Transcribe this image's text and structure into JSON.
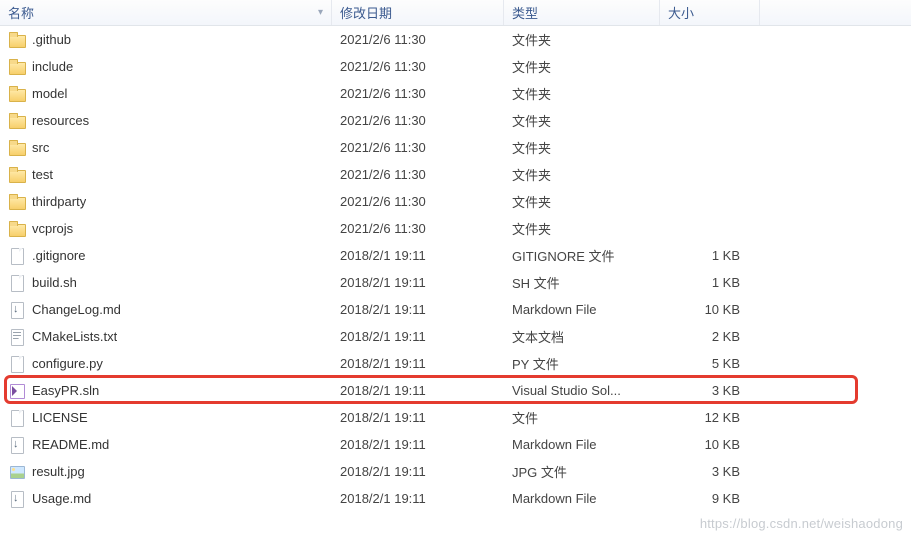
{
  "columns": {
    "name": "名称",
    "date": "修改日期",
    "type": "类型",
    "size": "大小"
  },
  "watermark": "https://blog.csdn.net/weishaodong",
  "rows": [
    {
      "icon": "folder",
      "name": ".github",
      "date": "2021/2/6 11:30",
      "type": "文件夹",
      "size": ""
    },
    {
      "icon": "folder",
      "name": "include",
      "date": "2021/2/6 11:30",
      "type": "文件夹",
      "size": ""
    },
    {
      "icon": "folder",
      "name": "model",
      "date": "2021/2/6 11:30",
      "type": "文件夹",
      "size": ""
    },
    {
      "icon": "folder",
      "name": "resources",
      "date": "2021/2/6 11:30",
      "type": "文件夹",
      "size": ""
    },
    {
      "icon": "folder",
      "name": "src",
      "date": "2021/2/6 11:30",
      "type": "文件夹",
      "size": ""
    },
    {
      "icon": "folder",
      "name": "test",
      "date": "2021/2/6 11:30",
      "type": "文件夹",
      "size": ""
    },
    {
      "icon": "folder",
      "name": "thirdparty",
      "date": "2021/2/6 11:30",
      "type": "文件夹",
      "size": ""
    },
    {
      "icon": "folder",
      "name": "vcprojs",
      "date": "2021/2/6 11:30",
      "type": "文件夹",
      "size": ""
    },
    {
      "icon": "file",
      "name": ".gitignore",
      "date": "2018/2/1 19:11",
      "type": "GITIGNORE 文件",
      "size": "1 KB"
    },
    {
      "icon": "file",
      "name": "build.sh",
      "date": "2018/2/1 19:11",
      "type": "SH 文件",
      "size": "1 KB"
    },
    {
      "icon": "md",
      "name": "ChangeLog.md",
      "date": "2018/2/1 19:11",
      "type": "Markdown File",
      "size": "10 KB"
    },
    {
      "icon": "txt",
      "name": "CMakeLists.txt",
      "date": "2018/2/1 19:11",
      "type": "文本文档",
      "size": "2 KB"
    },
    {
      "icon": "file",
      "name": "configure.py",
      "date": "2018/2/1 19:11",
      "type": "PY 文件",
      "size": "5 KB"
    },
    {
      "icon": "sln",
      "name": "EasyPR.sln",
      "date": "2018/2/1 19:11",
      "type": "Visual Studio Sol...",
      "size": "3 KB",
      "highlight": true
    },
    {
      "icon": "file",
      "name": "LICENSE",
      "date": "2018/2/1 19:11",
      "type": "文件",
      "size": "12 KB"
    },
    {
      "icon": "md",
      "name": "README.md",
      "date": "2018/2/1 19:11",
      "type": "Markdown File",
      "size": "10 KB"
    },
    {
      "icon": "img",
      "name": "result.jpg",
      "date": "2018/2/1 19:11",
      "type": "JPG 文件",
      "size": "3 KB"
    },
    {
      "icon": "md",
      "name": "Usage.md",
      "date": "2018/2/1 19:11",
      "type": "Markdown File",
      "size": "9 KB"
    }
  ]
}
